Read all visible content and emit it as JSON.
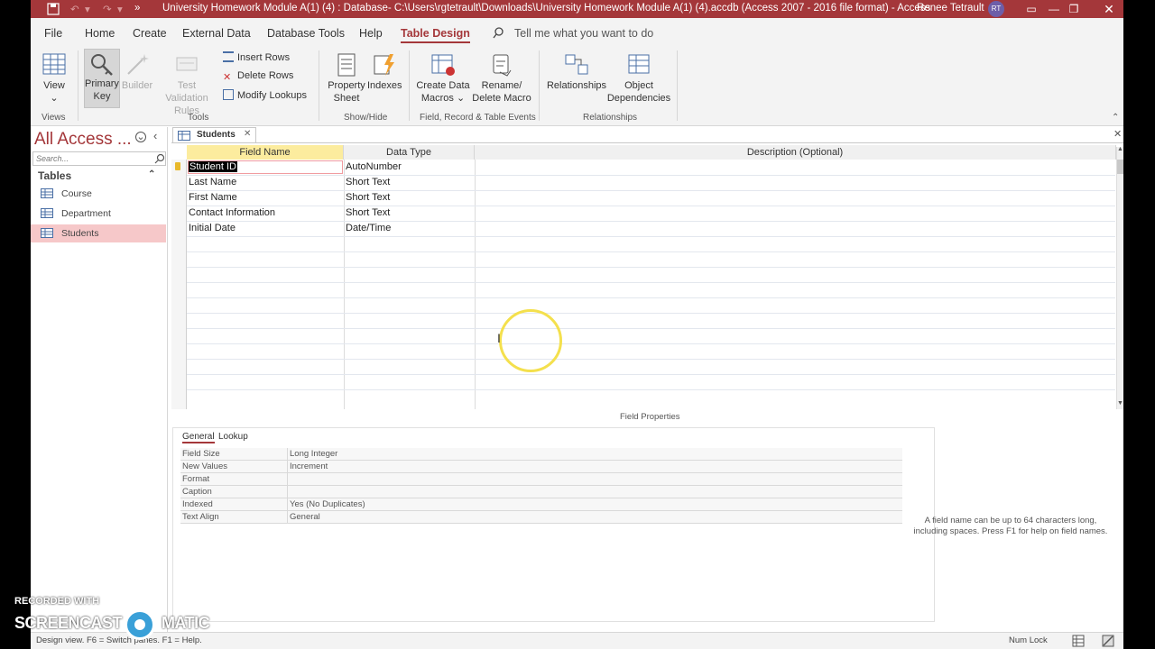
{
  "window": {
    "title": "University Homework Module A(1) (4) : Database- C:\\Users\\rgtetrault\\Downloads\\University Homework Module A(1) (4).accdb (Access 2007 - 2016 file format)  -  Access",
    "user_name": "Renee Tetrault",
    "user_initials": "RT"
  },
  "tabs": [
    "File",
    "Home",
    "Create",
    "External Data",
    "Database Tools",
    "Help",
    "Table Design"
  ],
  "tell_me": "Tell me what you want to do",
  "ribbon": {
    "view": "View",
    "primary_key": "Primary Key",
    "builder": "Builder",
    "test_validation": "Test Validation Rules",
    "insert_rows": "Insert Rows",
    "delete_rows": "Delete Rows",
    "modify_lookups": "Modify Lookups",
    "property_sheet": "Property Sheet",
    "indexes": "Indexes",
    "create_data_macros": "Create Data Macros",
    "rename_delete_macro": "Rename/ Delete Macro",
    "relationships": "Relationships",
    "object_dependencies": "Object Dependencies",
    "groups": {
      "views": "Views",
      "tools": "Tools",
      "show_hide": "Show/Hide",
      "field_events": "Field, Record & Table Events",
      "relationships": "Relationships"
    }
  },
  "nav": {
    "title": "All Access ...",
    "search_placeholder": "Search...",
    "section": "Tables",
    "items": [
      "Course",
      "Department",
      "Students"
    ]
  },
  "doc": {
    "tab_label": "Students",
    "columns": [
      "Field Name",
      "Data Type",
      "Description (Optional)"
    ],
    "rows": [
      {
        "field": "Student ID",
        "type": "AutoNumber"
      },
      {
        "field": "Last Name",
        "type": "Short Text"
      },
      {
        "field": "First Name",
        "type": "Short Text"
      },
      {
        "field": "Contact Information",
        "type": "Short Text"
      },
      {
        "field": "Initial Date",
        "type": "Date/Time"
      }
    ]
  },
  "field_properties": {
    "label": "Field Properties",
    "tabs": [
      "General",
      "Lookup"
    ],
    "rows": [
      {
        "label": "Field Size",
        "value": "Long Integer"
      },
      {
        "label": "New Values",
        "value": "Increment"
      },
      {
        "label": "Format",
        "value": ""
      },
      {
        "label": "Caption",
        "value": ""
      },
      {
        "label": "Indexed",
        "value": "Yes (No Duplicates)"
      },
      {
        "label": "Text Align",
        "value": "General"
      }
    ],
    "help_text": "A field name can be up to 64 characters long, including spaces. Press F1 for help on field names."
  },
  "status": {
    "left": "Design view.  F6 = Switch panes.  F1 = Help.",
    "num_lock": "Num Lock"
  },
  "watermark": {
    "line1": "RECORDED WITH",
    "line2a": "SCREENCAST",
    "line2b": "MATIC"
  },
  "colors": {
    "accent": "#a4373a",
    "selected_nav": "#f6c8c9",
    "selected_header": "#fcec9e"
  }
}
